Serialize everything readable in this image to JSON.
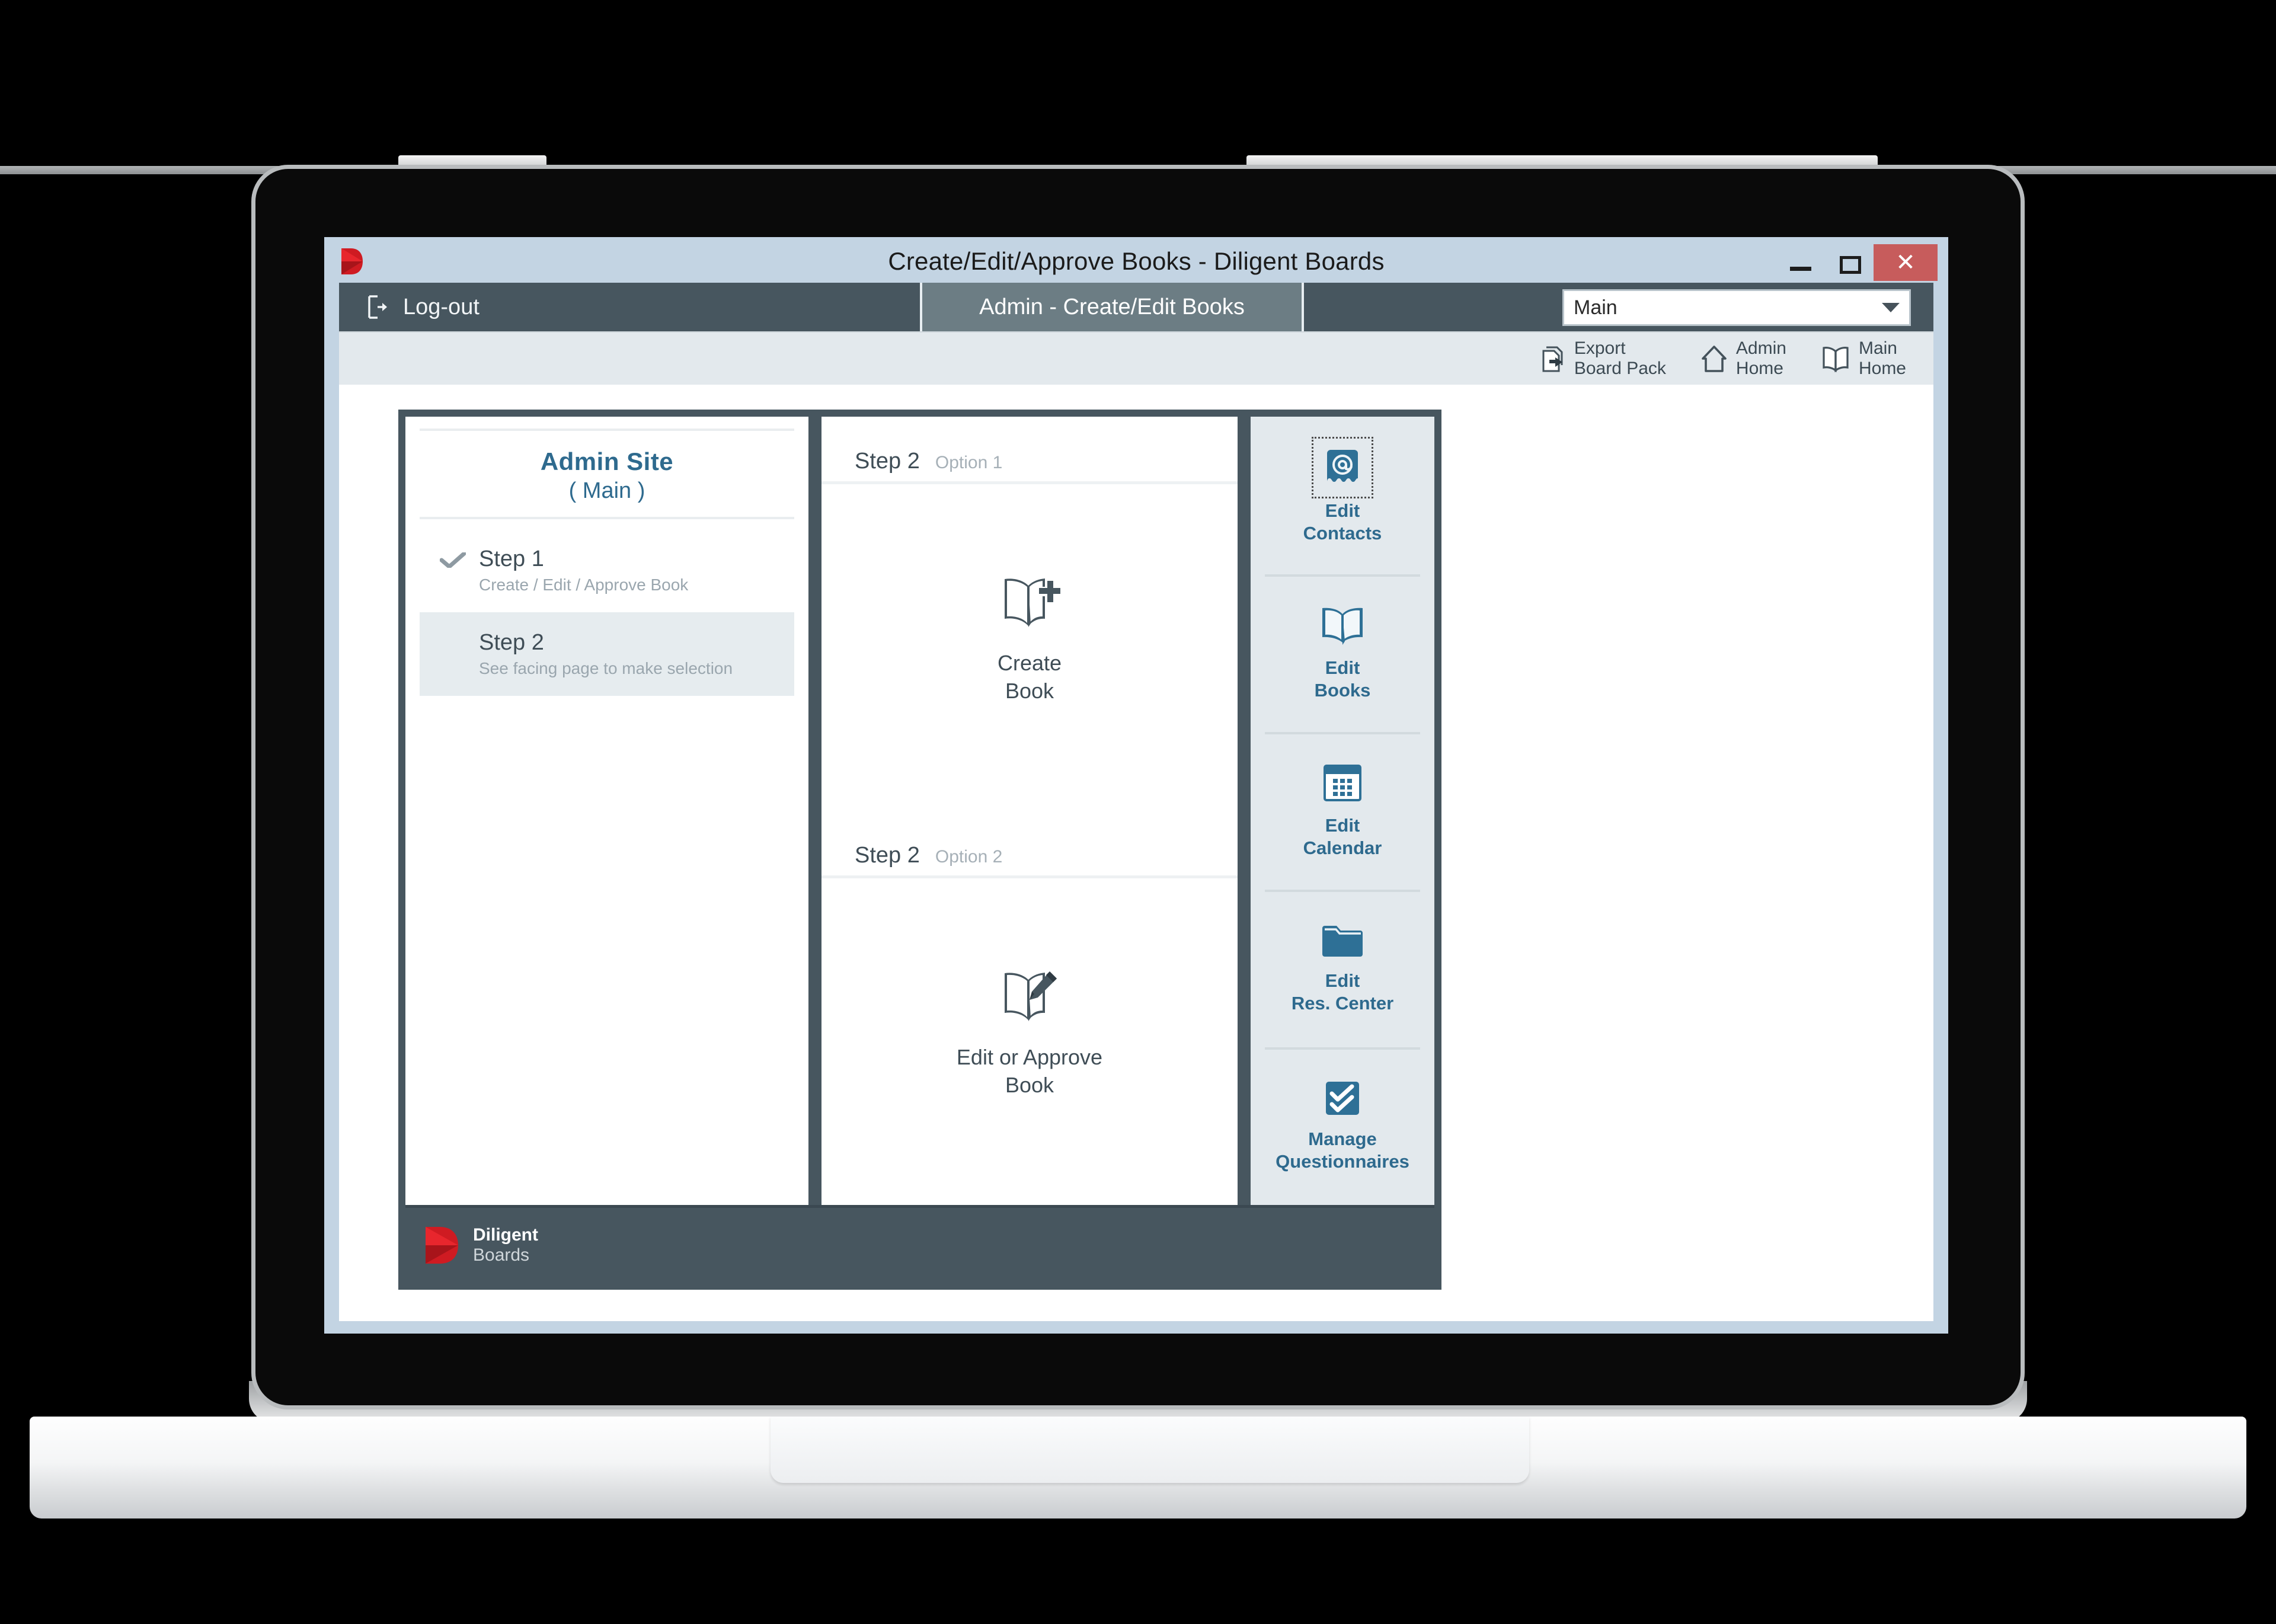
{
  "window": {
    "title": "Create/Edit/Approve Books - Diligent Boards",
    "minimize_label": "",
    "maximize_label": "",
    "close_label": "✕"
  },
  "nav": {
    "logout_label": "Log-out",
    "active_tab_label": "Admin - Create/Edit Books",
    "site_select_value": "Main"
  },
  "toolbar": {
    "items": [
      {
        "line1": "Export",
        "line2": "Board Pack",
        "icon": "export-icon"
      },
      {
        "line1": "Admin",
        "line2": "Home",
        "icon": "house-icon"
      },
      {
        "line1": "Main",
        "line2": "Home",
        "icon": "open-book-icon"
      }
    ]
  },
  "sidebar": {
    "title": "Admin Site",
    "subtitle": "( Main )",
    "steps": [
      {
        "name": "Step 1",
        "description": "Create / Edit / Approve Book",
        "completed": true,
        "active": false
      },
      {
        "name": "Step 2",
        "description": "See facing page to make selection",
        "completed": false,
        "active": true
      }
    ]
  },
  "options": [
    {
      "step": "Step 2",
      "option": "Option 1",
      "label_line1": "Create",
      "label_line2": "Book",
      "icon": "book-plus-icon"
    },
    {
      "step": "Step 2",
      "option": "Option 2",
      "label_line1": "Edit or Approve",
      "label_line2": "Book",
      "icon": "book-pencil-icon"
    }
  ],
  "action_rail": [
    {
      "line1": "Edit",
      "line2": "Contacts",
      "icon": "at-card-icon",
      "focused": true
    },
    {
      "line1": "Edit",
      "line2": "Books",
      "icon": "open-book-icon",
      "focused": false
    },
    {
      "line1": "Edit",
      "line2": "Calendar",
      "icon": "calendar-icon",
      "focused": false
    },
    {
      "line1": "Edit",
      "line2": "Res. Center",
      "icon": "folder-icon",
      "focused": false
    },
    {
      "line1": "Manage",
      "line2": "Questionnaires",
      "icon": "double-check-icon",
      "focused": false
    }
  ],
  "footer": {
    "brand_line1": "Diligent",
    "brand_line2": "Boards"
  },
  "colors": {
    "title_bar": "#c3d4e3",
    "nav_bar": "#47565f",
    "active_tab": "#6c7d84",
    "toolbar": "#e3e9ed",
    "accent_blue": "#2e6a8e",
    "brand_red": "#cf1b22",
    "close_red": "#c75c5c",
    "card_dark": "#47565f",
    "rail_bg": "#e3e9ed"
  }
}
